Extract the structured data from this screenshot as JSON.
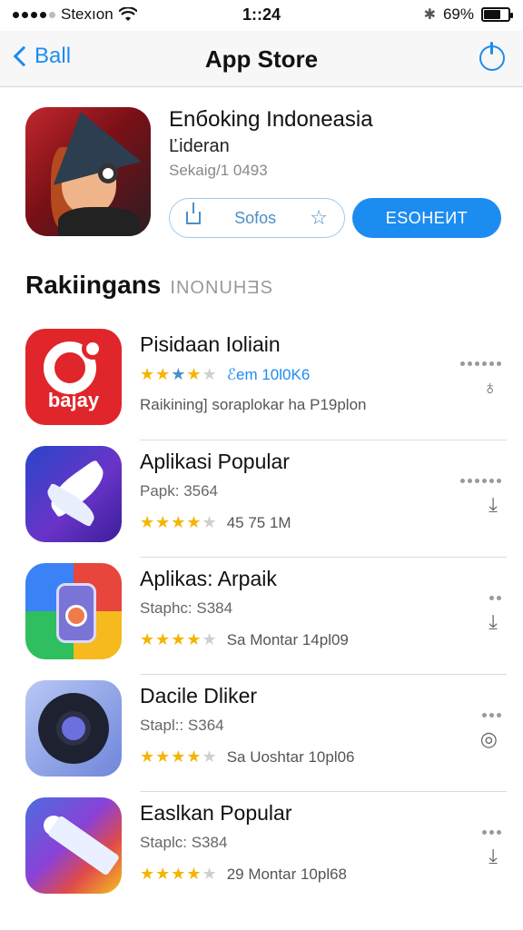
{
  "status_bar": {
    "carrier": "Stexıon",
    "time": "1::24",
    "battery_percent": "69%",
    "battery_level": 0.69
  },
  "nav": {
    "back_label": "Ball",
    "title": "App Store"
  },
  "featured": {
    "title": "Enбoking Indoneasia",
    "subtitle": "Ľideran",
    "meta": "Sekaig/1 0493",
    "secondary_label": "Sofos",
    "get_label": "ESOHEИT"
  },
  "section": {
    "title": "Rakiingans",
    "subtitle": "INONUHƎS"
  },
  "apps": [
    {
      "title": "Pisidaan Ioliain",
      "stars": 4.5,
      "line2_text": "ℰem 10l0K6",
      "line3_text": "Raikining] soraplokar  ha P19plon",
      "icon_brand": "bajay",
      "icon": "red-o-icon"
    },
    {
      "title": "Aplikasi Popular",
      "subtitle": "Papk: 3564",
      "stars": 4.5,
      "line3_text": "45 75 1M",
      "icon": "purple-wing-icon"
    },
    {
      "title": "Aplikas: Arpaik",
      "subtitle": "Staphc: S384",
      "stars": 4.5,
      "line3_text": "Sa Montar 14pl09",
      "icon": "colorful-device-icon"
    },
    {
      "title": "Dacile Dliker",
      "subtitle": "Stapl:: S364",
      "stars": 5,
      "line3_text": "Sa Uoshtar 10pl06",
      "icon": "camera-lens-icon"
    },
    {
      "title": "Easlkan Popular",
      "subtitle": "Staplc: S384",
      "stars": 4.5,
      "line3_text": "29 Montar 10pl68",
      "icon": "flag-gradient-icon"
    }
  ],
  "colors": {
    "accent": "#1d8cf0",
    "star": "#f5b400"
  }
}
